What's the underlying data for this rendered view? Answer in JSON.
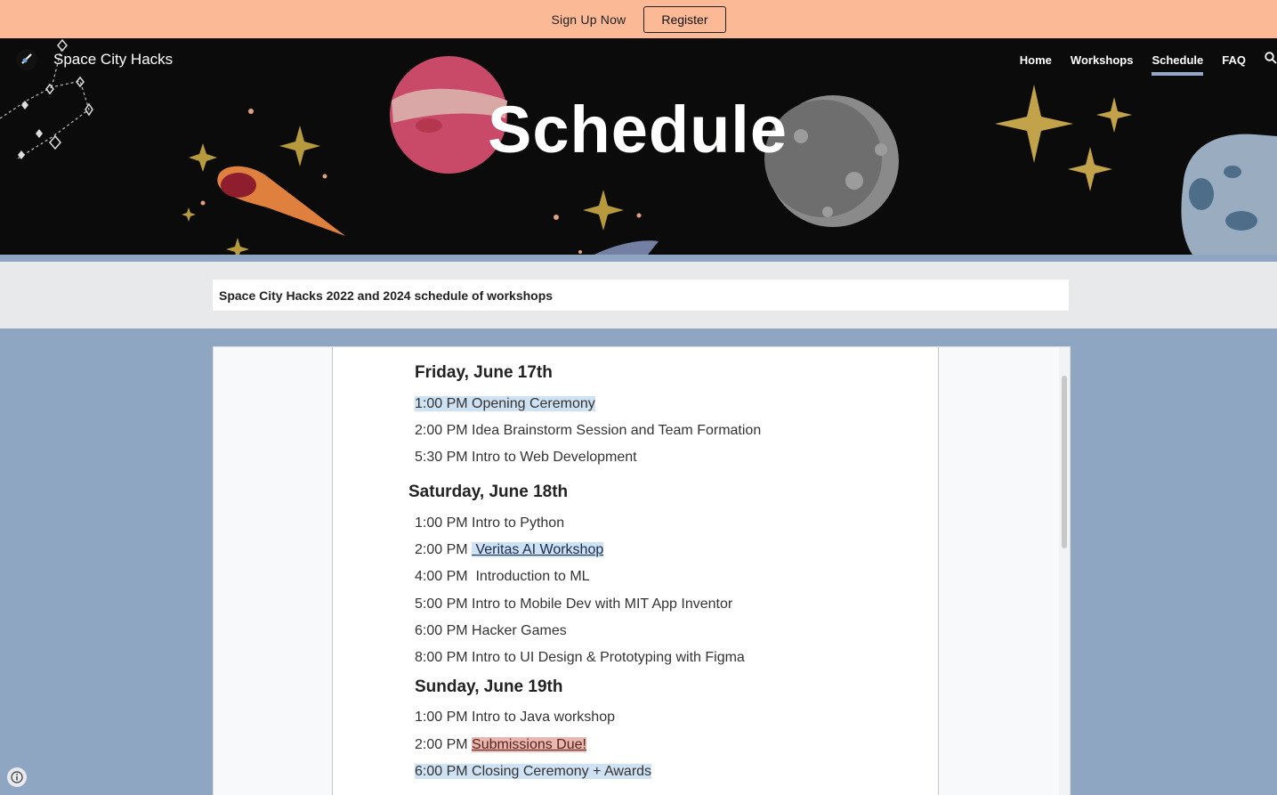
{
  "banner": {
    "signup_text": "Sign Up Now",
    "register_label": "Register"
  },
  "header": {
    "site_title": "Space City Hacks",
    "nav": [
      {
        "label": "Home",
        "active": false
      },
      {
        "label": "Workshops",
        "active": false
      },
      {
        "label": "Schedule",
        "active": true
      },
      {
        "label": "FAQ",
        "active": false
      }
    ],
    "search_icon": "search-icon"
  },
  "hero": {
    "title": "Schedule"
  },
  "description": "Space City Hacks 2022 and 2024 schedule of workshops",
  "schedule": {
    "friday": {
      "heading": "Friday, June 17th",
      "items": [
        {
          "time": "1:00 PM ",
          "event": "Opening Ceremony",
          "style": "highlight-blue-full"
        },
        {
          "time": "2:00 PM ",
          "event": "Idea Brainstorm Session and Team Formation",
          "style": "plain"
        },
        {
          "time": "5:30 PM ",
          "event": "Intro to Web Development",
          "style": "plain"
        }
      ]
    },
    "saturday": {
      "heading": "Saturday, June 18th",
      "items": [
        {
          "time": "1:00 PM ",
          "event": "Intro to Python",
          "style": "plain"
        },
        {
          "time": "2:00 PM ",
          "event": " Veritas AI Workshop",
          "style": "link-highlight"
        },
        {
          "time": "4:00 PM ",
          "event": " Introduction to ML",
          "style": "plain"
        },
        {
          "time": "5:00 PM ",
          "event": "Intro to Mobile Dev with MIT App Inventor",
          "style": "plain"
        },
        {
          "time": "6:00 PM ",
          "event": "Hacker Games",
          "style": "plain"
        },
        {
          "time": "8:00 PM ",
          "event": "Intro to UI Design & Prototyping with Figma",
          "style": "plain"
        }
      ]
    },
    "sunday": {
      "heading": "Sunday, June 19th",
      "items": [
        {
          "time": "1:00 PM ",
          "event": "Intro to Java workshop",
          "style": "plain"
        },
        {
          "time": "2:00 PM ",
          "event": "Submissions Due!",
          "style": "highlight-red"
        },
        {
          "time": "6:00 PM ",
          "event": "Closing Ceremony + Awards",
          "style": "highlight-blue-full"
        }
      ]
    }
  },
  "colors": {
    "banner": "#fbb995",
    "page_bg": "#8fa6c3",
    "nav_active": "#93a9c9",
    "hero_bg": "#0b0b0c"
  }
}
